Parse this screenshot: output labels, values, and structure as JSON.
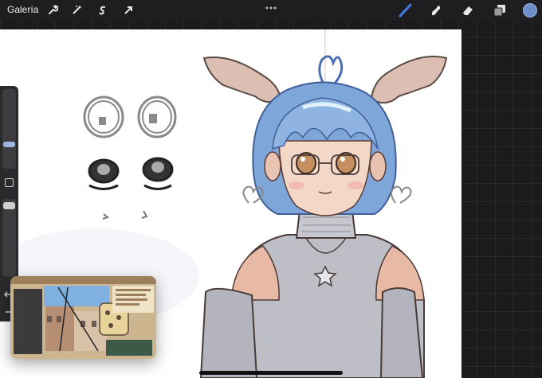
{
  "topbar": {
    "gallery_label": "Galería",
    "left_tools": [
      "wrench-icon",
      "magic-wand-icon",
      "selection-icon",
      "transform-arrow-icon"
    ],
    "right_tools": [
      "brush-icon",
      "smudge-icon",
      "eraser-icon",
      "layers-icon",
      "color-swatch"
    ],
    "active_tool": "brush-icon",
    "current_color": "#6d8fc9",
    "accent_color": "#3f7be0"
  },
  "sidebar": {
    "controls": [
      "brush-size-slider",
      "modify-button",
      "opacity-slider",
      "undo-button",
      "redo-button"
    ]
  },
  "canvas": {
    "background": "#ffffff"
  }
}
